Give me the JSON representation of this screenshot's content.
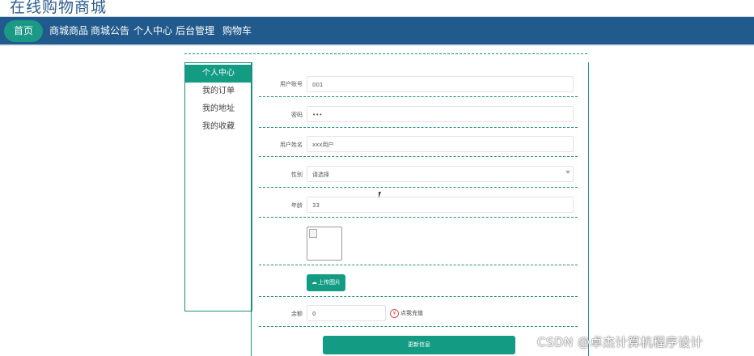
{
  "site": {
    "title": "在线购物商城"
  },
  "nav": {
    "home": "首页",
    "items": [
      "商城商品",
      "商城公告",
      "个人中心",
      "后台管理",
      "购物车"
    ]
  },
  "sidebar": {
    "items": [
      "个人中心",
      "我的订单",
      "我的地址",
      "我的收藏"
    ],
    "active_index": 0
  },
  "form": {
    "account": {
      "label": "用户账号",
      "value": "001"
    },
    "password": {
      "label": "密码",
      "value": "•••"
    },
    "name": {
      "label": "用户姓名",
      "value": "xxx用户"
    },
    "gender": {
      "label": "性别",
      "value": "请选择"
    },
    "age": {
      "label": "年龄",
      "value": "33"
    },
    "upload_label": "上传图片",
    "balance": {
      "label": "余额",
      "value": "0"
    },
    "recharge_label": "点我充值",
    "submit_label": "更新信息"
  },
  "watermark": "CSDN @卓杰计算机程序设计",
  "colors": {
    "nav": "#215a8c",
    "accent": "#139b83"
  }
}
